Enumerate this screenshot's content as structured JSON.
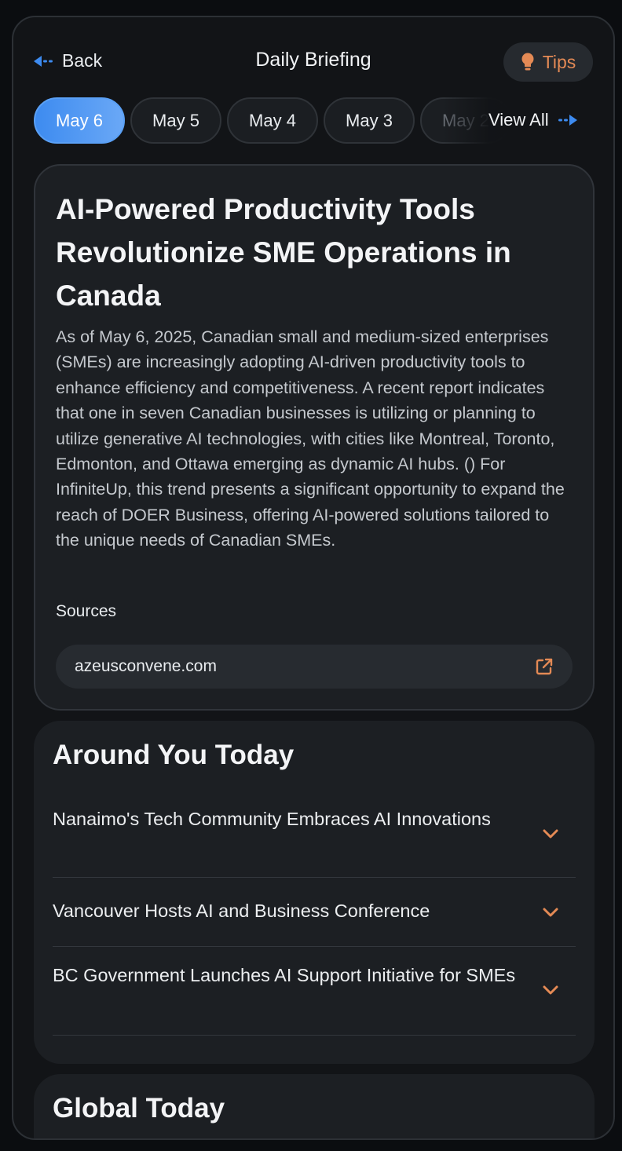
{
  "header": {
    "back_label": "Back",
    "title": "Daily Briefing",
    "tips_label": "Tips"
  },
  "dates": {
    "items": [
      "May 6",
      "May 5",
      "May 4",
      "May 3",
      "May 2"
    ],
    "active_index": 0,
    "view_all_label": "View All"
  },
  "main_story": {
    "title": "AI-Powered Productivity Tools Revolutionize SME Operations in Canada",
    "body": "As of May 6, 2025, Canadian small and medium-sized enterprises (SMEs) are increasingly adopting AI-driven productivity tools to enhance efficiency and competitiveness. A recent report indicates that one in seven Canadian businesses is utilizing or planning to utilize generative AI technologies, with cities like Montreal, Toronto, Edmonton, and Ottawa emerging as dynamic AI hubs. () For InfiniteUp, this trend presents a significant opportunity to expand the reach of DOER Business, offering AI-powered solutions tailored to the unique needs of Canadian SMEs.",
    "sources_label": "Sources",
    "sources": [
      "azeusconvene.com"
    ]
  },
  "around_you": {
    "title": "Around You Today",
    "items": [
      "Nanaimo's Tech Community Embraces AI Innovations",
      "Vancouver Hosts AI and Business Conference",
      "BC Government Launches AI Support Initiative for SMEs"
    ]
  },
  "global": {
    "title": "Global Today"
  },
  "colors": {
    "accent_blue": "#3d8bf0",
    "accent_orange": "#e48a55",
    "background": "#121417",
    "card": "#1c1f23"
  },
  "icons": {
    "back": "arrow-left-icon",
    "tips": "lightbulb-icon",
    "view_all": "arrow-right-icon",
    "external": "external-link-icon",
    "expand": "chevron-down-icon"
  }
}
